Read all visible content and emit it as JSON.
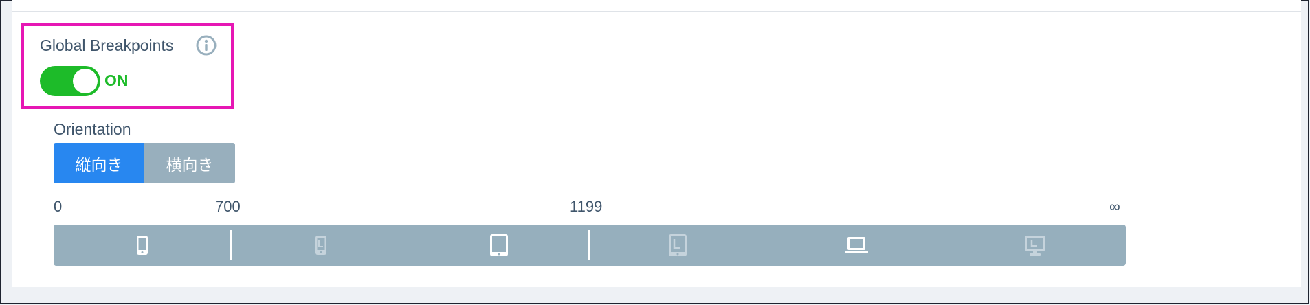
{
  "global_breakpoints": {
    "label": "Global Breakpoints",
    "info_icon": "info-icon",
    "toggle_state": "ON",
    "toggle_on": true,
    "accent_color": "#1dbb29"
  },
  "orientation": {
    "label": "Orientation",
    "options": [
      "縦向き",
      "横向き"
    ],
    "selected": "縦向き",
    "selected_color": "#2887f0"
  },
  "breakpoints": {
    "ticks": [
      "0",
      "700",
      "1199",
      "∞"
    ],
    "devices": [
      {
        "icon": "phone-portrait-icon",
        "active": true
      },
      {
        "icon": "phone-landscape-icon",
        "active": false
      },
      {
        "icon": "tablet-portrait-icon",
        "active": true
      },
      {
        "icon": "tablet-landscape-icon",
        "active": false
      },
      {
        "icon": "laptop-icon",
        "active": true
      },
      {
        "icon": "desktop-icon",
        "active": false
      }
    ]
  },
  "highlight_color": "#e617b4"
}
